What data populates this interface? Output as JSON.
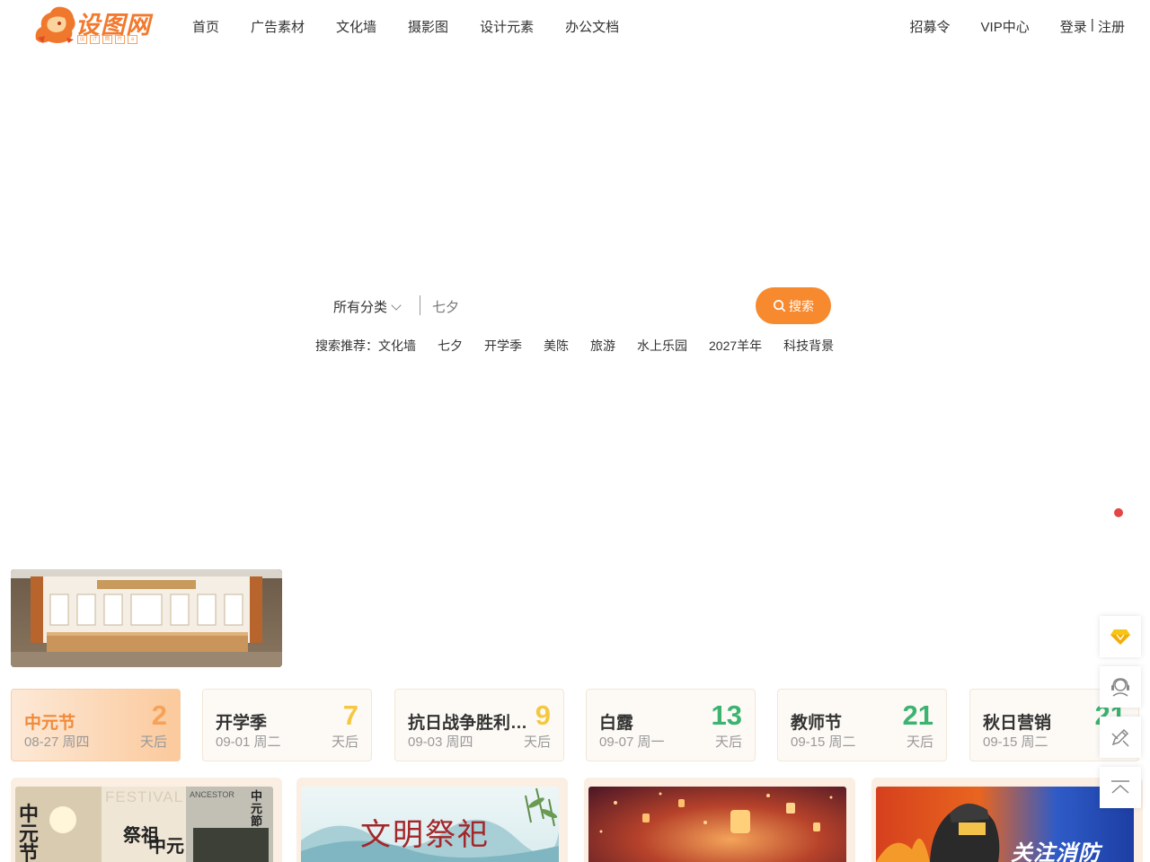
{
  "logo": {
    "text": "设图网",
    "sub": [
      "设",
      "计",
      "图",
      "片",
      "a"
    ]
  },
  "nav": {
    "items": [
      "首页",
      "广告素材",
      "文化墙",
      "摄影图",
      "设计元素",
      "办公文档"
    ],
    "right": {
      "recruit": "招募令",
      "vip": "VIP中心",
      "login": "登录",
      "sep": " | ",
      "register": "注册"
    }
  },
  "search": {
    "category": "所有分类",
    "placeholder": "七夕",
    "button": "搜索",
    "hot_label": "搜索推荐：",
    "hot": [
      "文化墙",
      "七夕",
      "开学季",
      "美陈",
      "旅游",
      "水上乐园",
      "2027羊年",
      "科技背景"
    ]
  },
  "festivals": [
    {
      "name": "中元节",
      "date": "08-27 周四",
      "days": "2",
      "suffix": "天后",
      "color": "#f5a25a"
    },
    {
      "name": "开学季",
      "date": "09-01 周二",
      "days": "7",
      "suffix": "天后",
      "color": "#f5c842"
    },
    {
      "name": "抗日战争胜利纪念日",
      "date": "09-03 周四",
      "days": "9",
      "suffix": "天后",
      "color": "#f5c842"
    },
    {
      "name": "白露",
      "date": "09-07 周一",
      "days": "13",
      "suffix": "天后",
      "color": "#3cb371"
    },
    {
      "name": "教师节",
      "date": "09-15 周二",
      "days": "21",
      "suffix": "天后",
      "color": "#3cb371"
    },
    {
      "name": "秋日营销",
      "date": "09-15 周二",
      "days": "21",
      "suffix": "天后",
      "color": "#3cb371"
    }
  ],
  "thumbs": {
    "t1": {
      "a": "中元节",
      "b": "祭祖",
      "c": "中元",
      "d": "中元節",
      "e": "FESTIVAL",
      "f": "ANCESTOR"
    },
    "t2": {
      "title": "文明祭祀"
    },
    "t4": {
      "title": "关注消防"
    }
  },
  "colors": {
    "accent": "#f7892f",
    "active_card": "#fbc99c"
  }
}
